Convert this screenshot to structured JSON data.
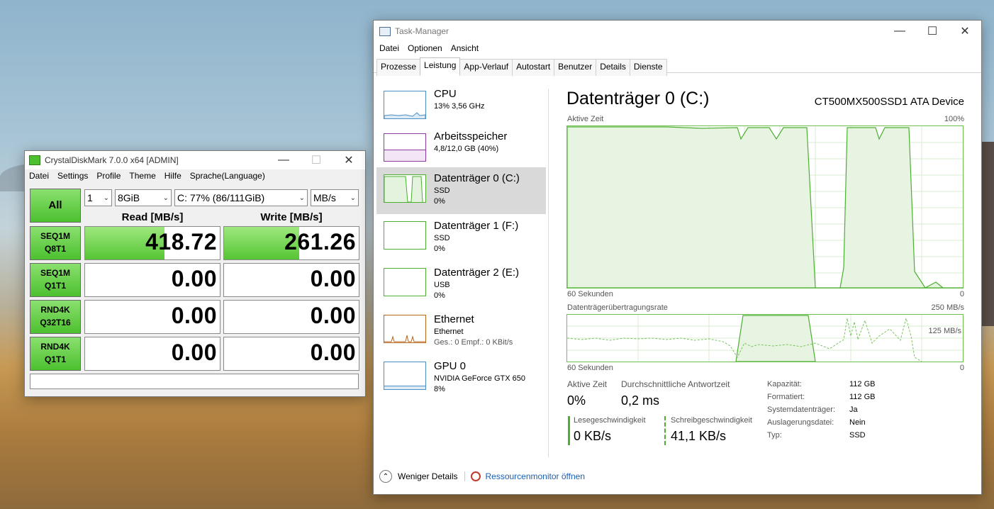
{
  "cdm": {
    "title": "CrystalDiskMark 7.0.0 x64 [ADMIN]",
    "menu": [
      "Datei",
      "Settings",
      "Profile",
      "Theme",
      "Hilfe",
      "Sprache(Language)"
    ],
    "all_label": "All",
    "count": "1",
    "size": "8GiB",
    "drive": "C: 77% (86/111GiB)",
    "unit": "MB/s",
    "read_header": "Read [MB/s]",
    "write_header": "Write [MB/s]",
    "rows": [
      {
        "l1": "SEQ1M",
        "l2": "Q8T1",
        "read": "418.72",
        "write": "261.26",
        "read_fill": 0.59,
        "write_fill": 0.56
      },
      {
        "l1": "SEQ1M",
        "l2": "Q1T1",
        "read": "0.00",
        "write": "0.00",
        "read_fill": 0,
        "write_fill": 0
      },
      {
        "l1": "RND4K",
        "l2": "Q32T16",
        "read": "0.00",
        "write": "0.00",
        "read_fill": 0,
        "write_fill": 0
      },
      {
        "l1": "RND4K",
        "l2": "Q1T1",
        "read": "0.00",
        "write": "0.00",
        "read_fill": 0,
        "write_fill": 0
      }
    ],
    "comment": ""
  },
  "tm": {
    "title": "Task-Manager",
    "menu": [
      "Datei",
      "Optionen",
      "Ansicht"
    ],
    "tabs": [
      "Prozesse",
      "Leistung",
      "App-Verlauf",
      "Autostart",
      "Benutzer",
      "Details",
      "Dienste"
    ],
    "active_tab": "Leistung",
    "sidebar": [
      {
        "title": "CPU",
        "sub1": "13% 3,56 GHz",
        "sub2": "",
        "color": "#4a90c6"
      },
      {
        "title": "Arbeitsspeicher",
        "sub1": "4,8/12,0 GB (40%)",
        "sub2": "",
        "color": "#8b3aa0"
      },
      {
        "title": "Datenträger 0 (C:)",
        "sub1": "SSD",
        "sub2": "0%",
        "color": "#4caf32"
      },
      {
        "title": "Datenträger 1 (F:)",
        "sub1": "SSD",
        "sub2": "0%",
        "color": "#4caf32"
      },
      {
        "title": "Datenträger 2 (E:)",
        "sub1": "USB",
        "sub2": "0%",
        "color": "#4caf32"
      },
      {
        "title": "Ethernet",
        "sub1": "Ethernet",
        "sub2": "Ges.: 0 Empf.: 0 KBit/s",
        "color": "#b8651c"
      },
      {
        "title": "GPU 0",
        "sub1": "NVIDIA GeForce GTX 650",
        "sub2": "8%",
        "color": "#4a90c6"
      }
    ],
    "main": {
      "title": "Datenträger 0 (C:)",
      "device": "CT500MX500SSD1 ATA Device",
      "g1_label": "Aktive Zeit",
      "g1_max": "100%",
      "g1_xl": "60 Sekunden",
      "g1_xr": "0",
      "g2_label": "Datenträgerübertragungsrate",
      "g2_max": "250 MB/s",
      "g2_mid": "125 MB/s",
      "g2_xl": "60 Sekunden",
      "g2_xr": "0",
      "active_label": "Aktive Zeit",
      "active_val": "0%",
      "resp_label": "Durchschnittliche Antwortzeit",
      "resp_val": "0,2 ms",
      "read_label": "Lesegeschwindigkeit",
      "read_val": "0 KB/s",
      "write_label": "Schreibgeschwindigkeit",
      "write_val": "41,1 KB/s",
      "props": [
        {
          "k": "Kapazität:",
          "v": "112 GB"
        },
        {
          "k": "Formatiert:",
          "v": "112 GB"
        },
        {
          "k": "Systemdatenträger:",
          "v": "Ja"
        },
        {
          "k": "Auslagerungsdatei:",
          "v": "Nein"
        },
        {
          "k": "Typ:",
          "v": "SSD"
        }
      ]
    },
    "footer_less": "Weniger Details",
    "footer_resmon": "Ressourcenmonitor öffnen"
  }
}
